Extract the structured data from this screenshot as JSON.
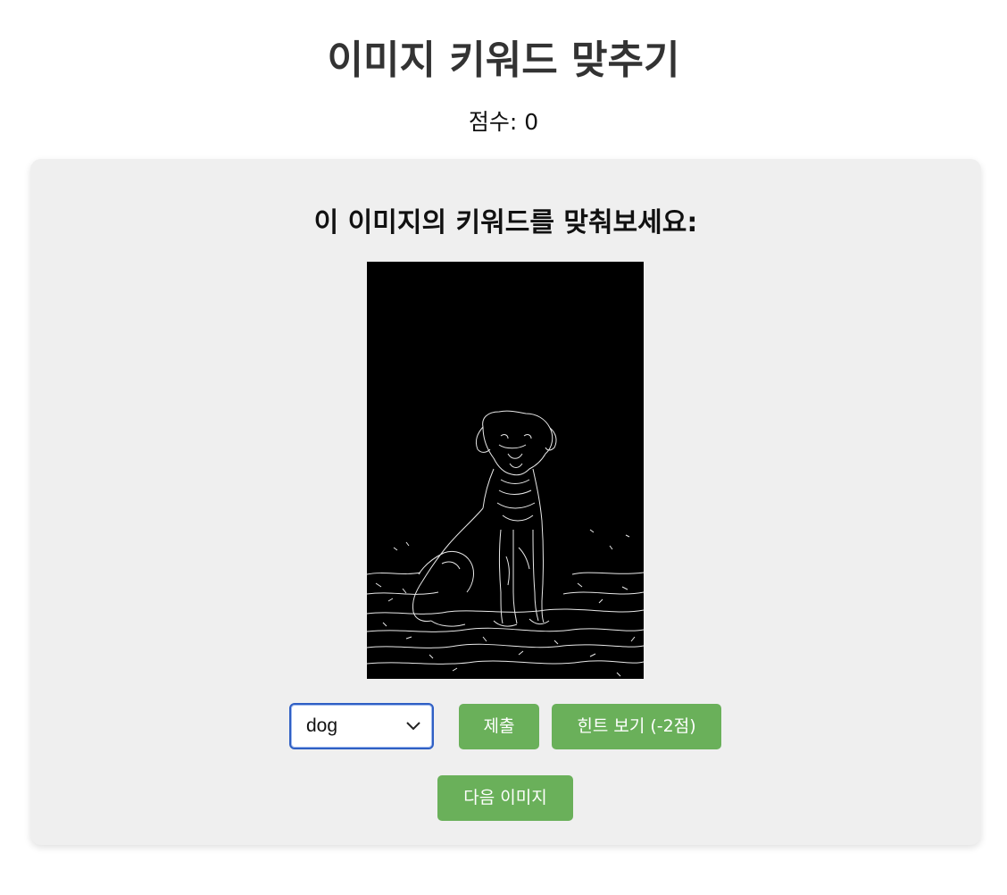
{
  "header": {
    "title": "이미지 키워드 맞추기",
    "score_label": "점수: 0"
  },
  "quiz": {
    "prompt": "이 이미지의 키워드를 맞춰보세요:",
    "image_icon": "edge-detected-dog-image",
    "keyword_select": {
      "selected": "dog"
    },
    "buttons": {
      "submit": "제출",
      "hint": "힌트 보기 (-2점)",
      "next": "다음 이미지"
    }
  },
  "colors": {
    "button_green": "#6ab05a",
    "card_background": "#efefef",
    "select_focus_border": "#2f5fc4"
  }
}
